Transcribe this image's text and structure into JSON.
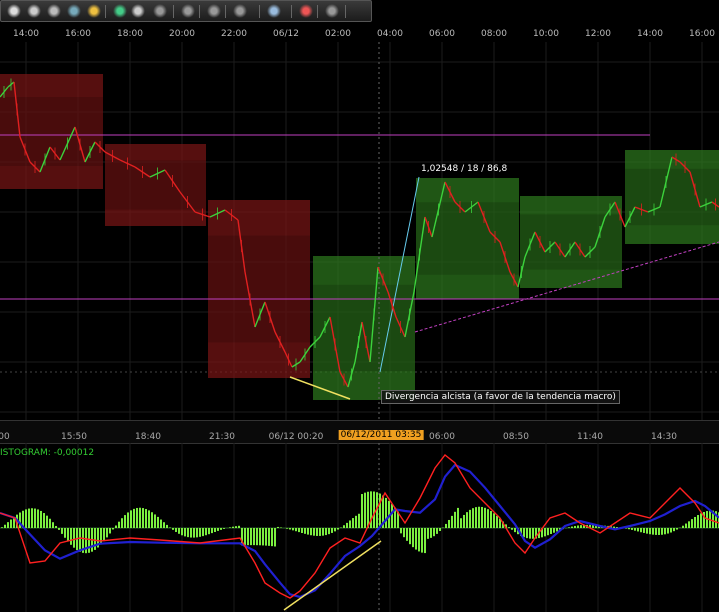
{
  "toolbar": {
    "icons": [
      "cursor-icon",
      "speech-icon",
      "eye-icon",
      "globe-icon",
      "pencil-icon",
      "flag-icon",
      "copy-icon",
      "line-tool-icon",
      "trendline-icon",
      "channel-icon",
      "pitchfork-icon",
      "ellipse-icon",
      "eraser-icon",
      "settings-icon"
    ]
  },
  "top_axis": {
    "labels": [
      "14:00",
      "16:00",
      "18:00",
      "20:00",
      "22:00",
      "06/12",
      "02:00",
      "04:00",
      "06:00",
      "08:00",
      "10:00",
      "12:00",
      "14:00",
      "16:00"
    ]
  },
  "mid_axis": {
    "labels": [
      "00",
      "15:50",
      "18:40",
      "21:30",
      "06/12 00:20",
      "06:00",
      "08:50",
      "11:40",
      "14:30"
    ],
    "cursor_time": "06/12/2011 03:35"
  },
  "indicator": {
    "label": "ISTOGRAM: -0,00012"
  },
  "annotations": {
    "measure": "1,02548 / 18 / 86,8",
    "divergence": "Divergencia alcista (a favor de la tendencia macro)"
  },
  "colors": {
    "bear_box": "#7a1515",
    "bull_box": "#2e7a1e",
    "hline": "#c040c0",
    "trend": "#66ccee",
    "div_line": "#f0e060",
    "hist": "#7cf040",
    "macd": "#ff2020",
    "signal": "#2020d0",
    "cursor_label": "#f0a020"
  }
}
